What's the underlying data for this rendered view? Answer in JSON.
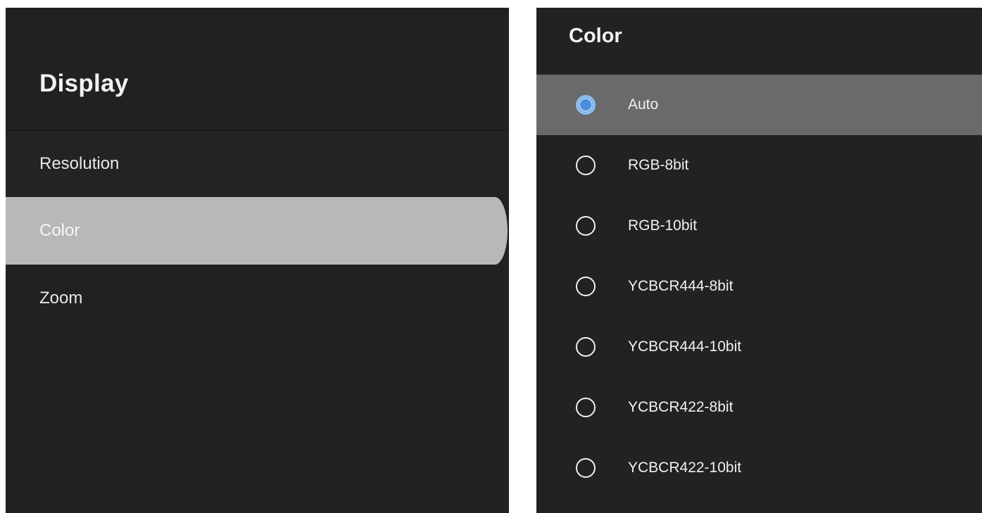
{
  "left_panel": {
    "title": "Display",
    "items": [
      {
        "label": "Resolution"
      },
      {
        "label": "Color"
      },
      {
        "label": "Zoom"
      }
    ],
    "selected_index": 1
  },
  "right_panel": {
    "title": "Color",
    "options": [
      {
        "label": "Auto",
        "checked": true
      },
      {
        "label": "RGB-8bit",
        "checked": false
      },
      {
        "label": "RGB-10bit",
        "checked": false
      },
      {
        "label": "YCBCR444-8bit",
        "checked": false
      },
      {
        "label": "YCBCR444-10bit",
        "checked": false
      },
      {
        "label": "YCBCR422-8bit",
        "checked": false
      },
      {
        "label": "YCBCR422-10bit",
        "checked": false
      }
    ]
  },
  "colors": {
    "panel_bg": "#222224",
    "selected_menu_bg": "#b7b8b7",
    "selected_option_bg": "#6a6a6b",
    "radio_accent": "#4b8fdc"
  },
  "icons": {
    "radio_checked": "radio-checked-icon",
    "radio_unchecked": "radio-unchecked-icon"
  }
}
